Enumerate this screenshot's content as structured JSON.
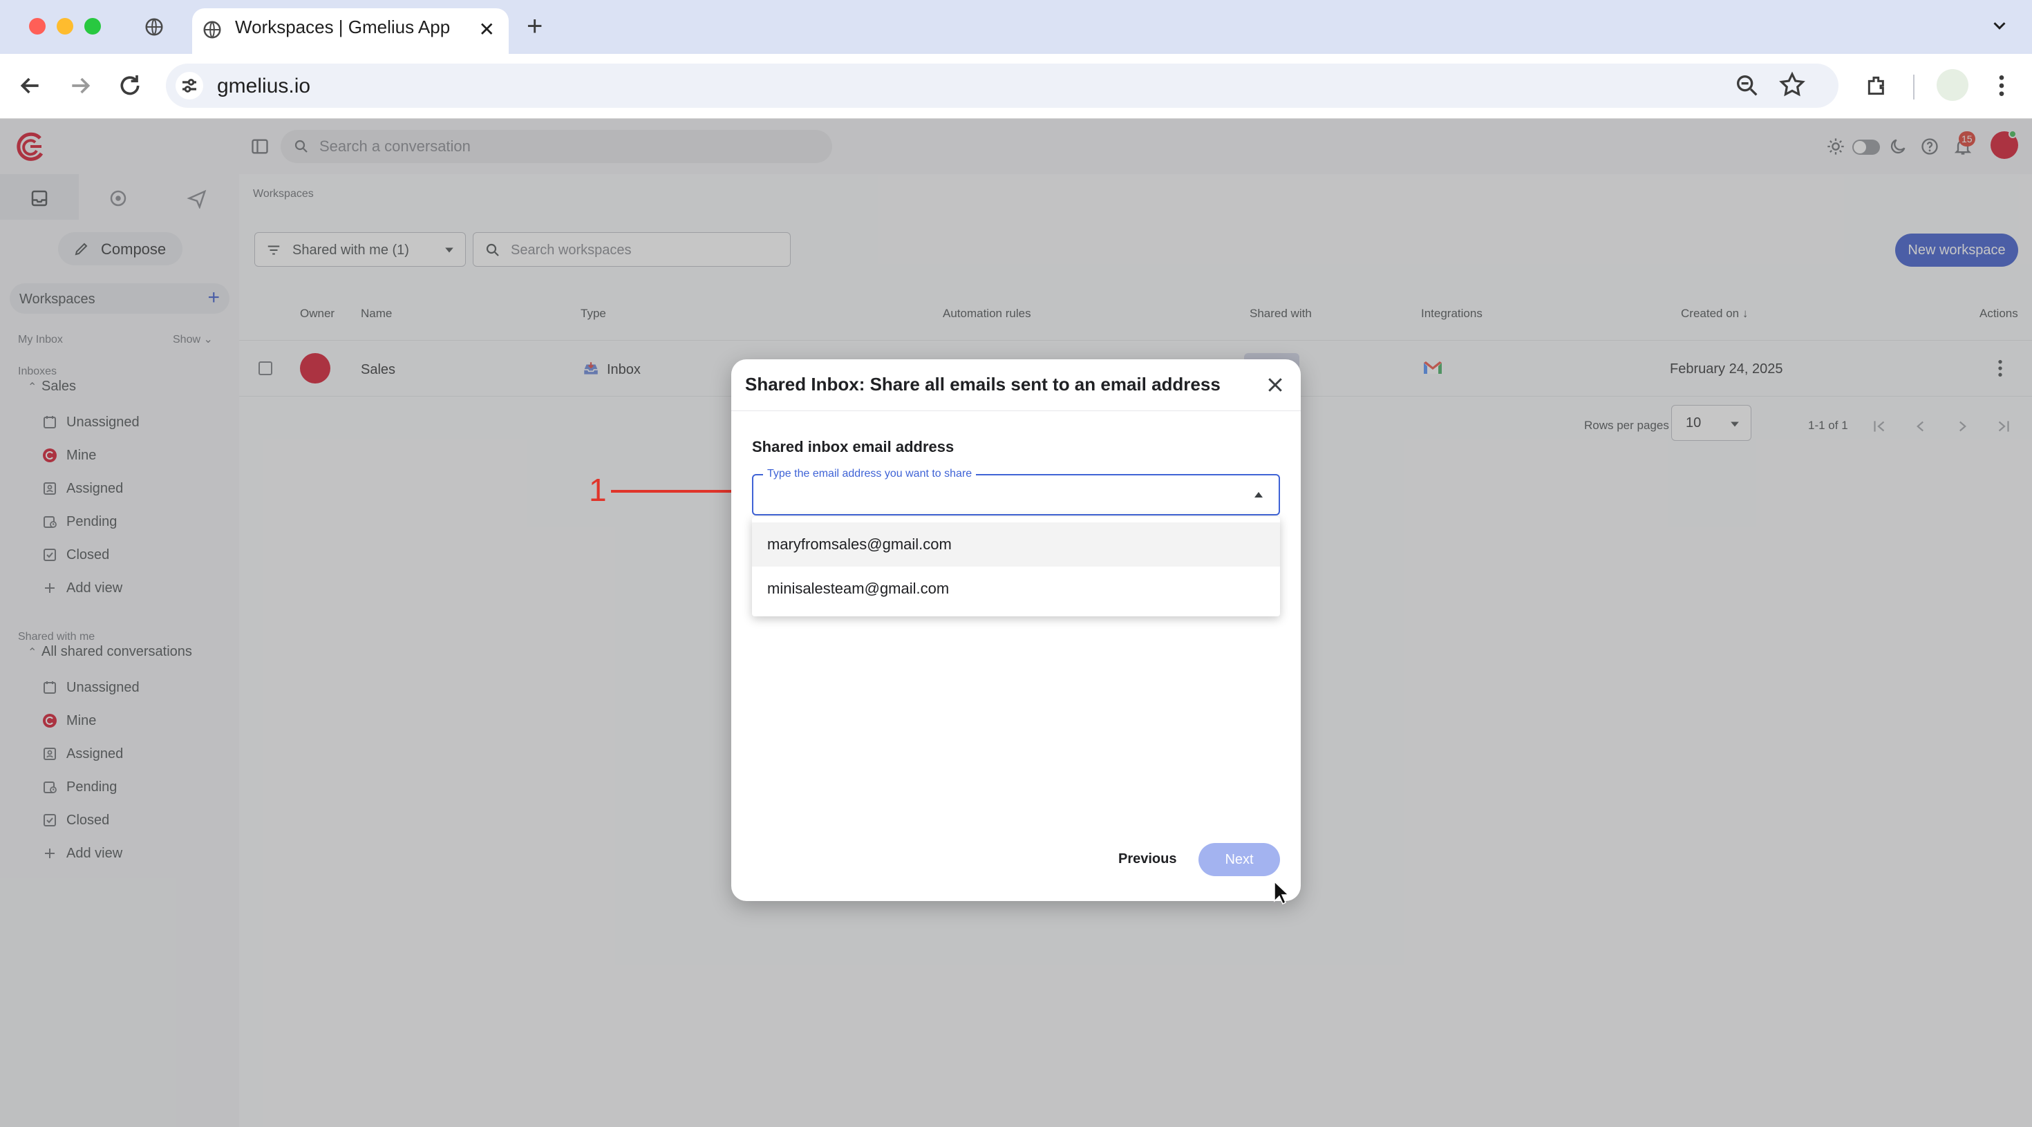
{
  "browser": {
    "tab_title": "Workspaces | Gmelius App",
    "url": "gmelius.io"
  },
  "app": {
    "search_placeholder": "Search a conversation",
    "notification_count": "15",
    "brand_color": "#d0021b",
    "accent_color": "#2c4cc8"
  },
  "sidebar": {
    "compose_label": "Compose",
    "workspaces_label": "Workspaces",
    "my_inbox_label": "My Inbox",
    "show_label": "Show",
    "inboxes_label": "Inboxes",
    "sales_label": "Sales",
    "sales_items": [
      {
        "label": "Unassigned",
        "icon": "unassigned-icon"
      },
      {
        "label": "Mine",
        "icon": "user-avatar-icon"
      },
      {
        "label": "Assigned",
        "icon": "assigned-icon"
      },
      {
        "label": "Pending",
        "icon": "pending-icon"
      },
      {
        "label": "Closed",
        "icon": "closed-icon"
      },
      {
        "label": "Add view",
        "icon": "plus-icon"
      }
    ],
    "shared_with_me_label": "Shared with me",
    "all_shared_label": "All shared conversations",
    "shared_items": [
      {
        "label": "Unassigned",
        "icon": "unassigned-icon"
      },
      {
        "label": "Mine",
        "icon": "user-avatar-icon"
      },
      {
        "label": "Assigned",
        "icon": "assigned-icon"
      },
      {
        "label": "Pending",
        "icon": "pending-icon"
      },
      {
        "label": "Closed",
        "icon": "closed-icon"
      },
      {
        "label": "Add view",
        "icon": "plus-icon"
      }
    ]
  },
  "main": {
    "breadcrumb": "Workspaces",
    "filter_label": "Shared with me (1)",
    "search_placeholder": "Search workspaces",
    "new_workspace_label": "New workspace",
    "columns": [
      "Owner",
      "Name",
      "Type",
      "Automation rules",
      "Shared with",
      "Integrations",
      "Created on",
      "Actions"
    ],
    "row": {
      "name": "Sales",
      "type": "Inbox",
      "created_on": "February 24, 2025"
    },
    "rows_per_page_label": "Rows per pages",
    "rows_per_page_value": "10",
    "page_range": "1-1 of 1"
  },
  "modal": {
    "title": "Shared Inbox: Share all emails sent to an email address",
    "field_heading": "Shared inbox email address",
    "field_label": "Type the email address you want to share",
    "field_value": "",
    "options": [
      "maryfromsales@gmail.com",
      "minisalesteam@gmail.com"
    ],
    "previous_label": "Previous",
    "next_label": "Next"
  },
  "annotation": {
    "number": "1",
    "color": "#e0342a"
  }
}
